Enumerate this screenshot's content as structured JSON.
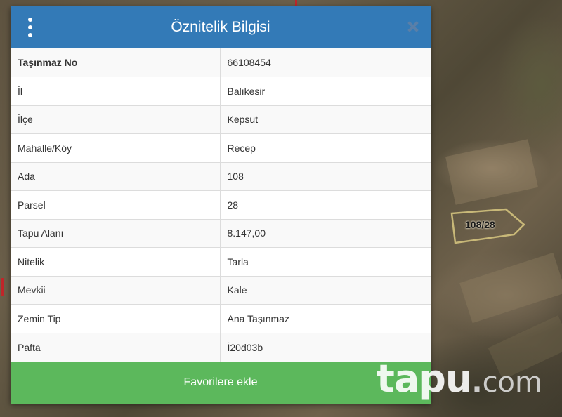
{
  "modal": {
    "title": "Öznitelik Bilgisi",
    "menu_icon": "vertical-dots-icon",
    "close_icon": "close-icon",
    "rows": [
      {
        "key": "Taşınmaz No",
        "value": "66108454"
      },
      {
        "key": "İl",
        "value": "Balıkesir"
      },
      {
        "key": "İlçe",
        "value": "Kepsut"
      },
      {
        "key": "Mahalle/Köy",
        "value": "Recep"
      },
      {
        "key": "Ada",
        "value": "108"
      },
      {
        "key": "Parsel",
        "value": "28"
      },
      {
        "key": "Tapu Alanı",
        "value": "8.147,00"
      },
      {
        "key": "Nitelik",
        "value": "Tarla"
      },
      {
        "key": "Mevkii",
        "value": "Kale"
      },
      {
        "key": "Zemin Tip",
        "value": "Ana Taşınmaz"
      },
      {
        "key": "Pafta",
        "value": "İ20d03b"
      }
    ],
    "favorite_button": "Favorilere ekle"
  },
  "map": {
    "parcel_label": "108/28"
  },
  "watermark": {
    "brand": "tapu",
    "dot": ".",
    "tld": "com"
  },
  "colors": {
    "header": "#337ab7",
    "button": "#5cb85c",
    "parcel_outline": "#c8b878"
  }
}
